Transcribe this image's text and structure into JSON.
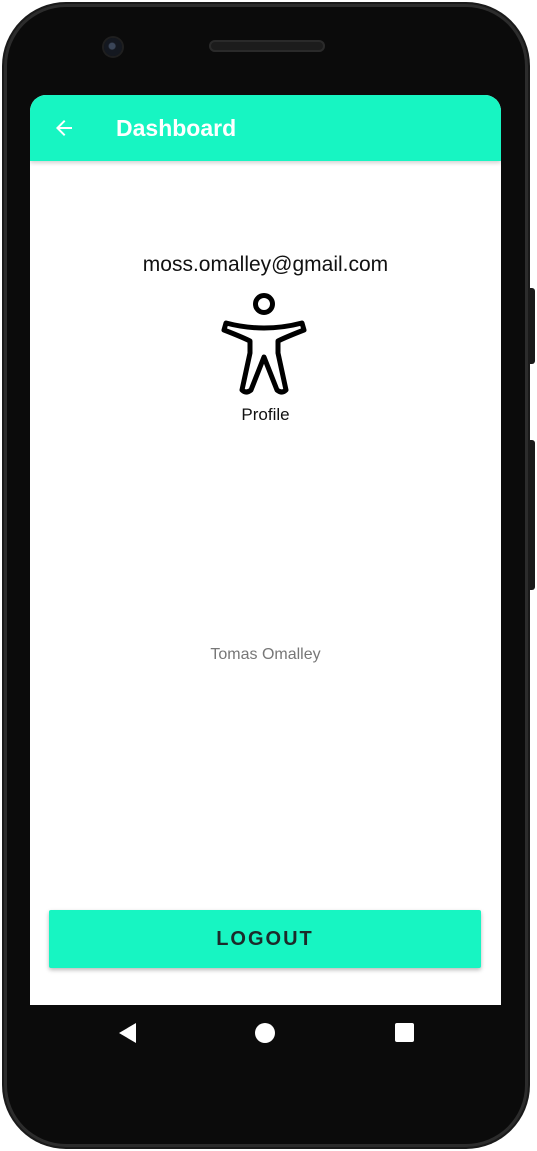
{
  "app_bar": {
    "title": "Dashboard",
    "back_icon": "arrow-left-icon",
    "background_color": "#17f5c2"
  },
  "profile": {
    "email": "moss.omalley@gmail.com",
    "icon": "accessibility-person-icon",
    "label": "Profile",
    "name": "Tomas Omalley"
  },
  "actions": {
    "logout_label": "LOGOUT",
    "button_color": "#17f5c2"
  },
  "system_nav": {
    "back_icon": "nav-back-triangle-icon",
    "home_icon": "nav-home-circle-icon",
    "recents_icon": "nav-recents-square-icon"
  }
}
